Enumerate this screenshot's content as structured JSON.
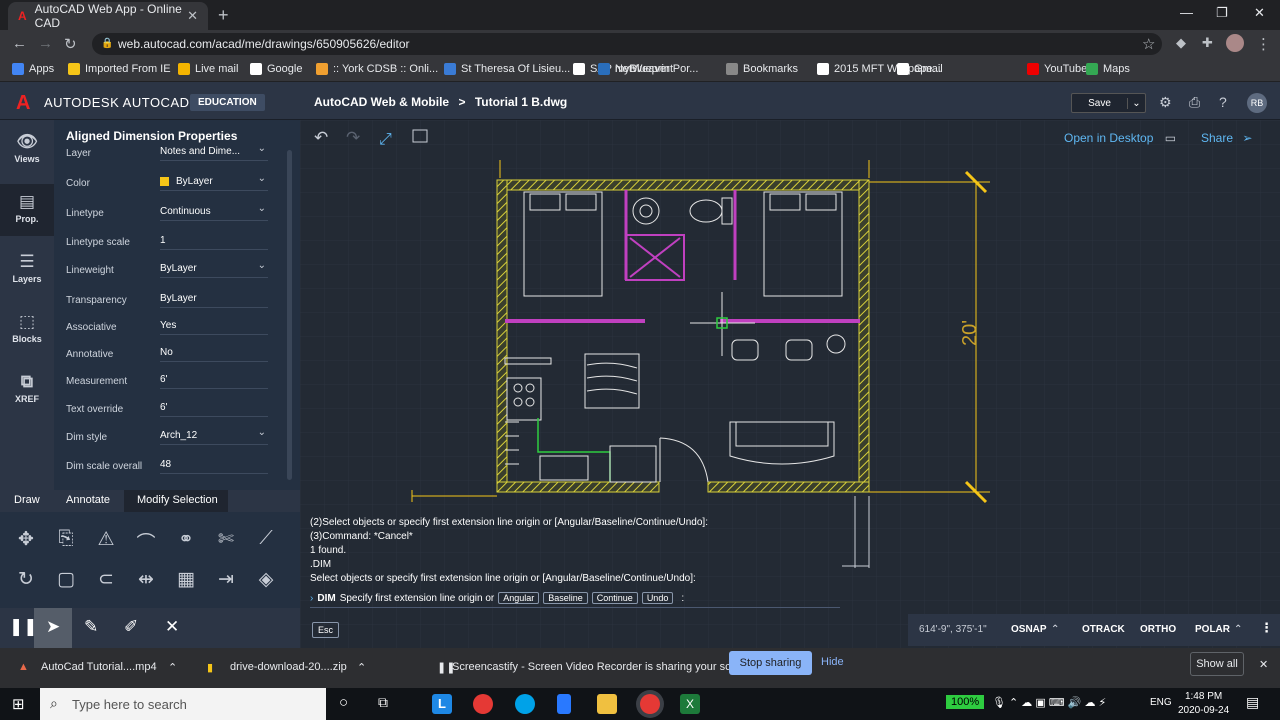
{
  "browser": {
    "tab_title": "AutoCAD Web App - Online CAD",
    "url": "web.autocad.com/acad/me/drawings/650905626/editor",
    "bookmarks": [
      "Apps",
      "Imported From IE",
      "Live mail",
      "Google",
      ":: York CDSB :: Onli...",
      "St Theresa Of Lisieu...",
      "SAP NetWeaver Por...",
      "myBlueprint",
      "Bookmarks",
      "2015 MFT Wallpape...",
      "Gmail",
      "YouTube",
      "Maps"
    ]
  },
  "app": {
    "brand": "AUTODESK AUTOCAD",
    "edition": "EDUCATION",
    "product": "AutoCAD Web & Mobile",
    "separator": ">",
    "file": "Tutorial 1 B.dwg",
    "save": "Save",
    "avatar": "RB",
    "open_desktop": "Open in Desktop",
    "share": "Share"
  },
  "rail": [
    {
      "label": "Views",
      "icon": "eye-icon"
    },
    {
      "label": "Prop.",
      "icon": "properties-icon"
    },
    {
      "label": "Layers",
      "icon": "layers-icon"
    },
    {
      "label": "Blocks",
      "icon": "blocks-icon"
    },
    {
      "label": "XREF",
      "icon": "xref-icon"
    }
  ],
  "properties": {
    "title": "Aligned Dimension Properties",
    "rows": [
      {
        "label": "Layer",
        "value": "Notes and Dime..."
      },
      {
        "label": "Color",
        "value": "ByLayer",
        "color": "#f5c518"
      },
      {
        "label": "Linetype",
        "value": "Continuous"
      },
      {
        "label": "Linetype scale",
        "value": "1"
      },
      {
        "label": "Lineweight",
        "value": "ByLayer"
      },
      {
        "label": "Transparency",
        "value": "ByLayer"
      },
      {
        "label": "Associative",
        "value": "Yes"
      },
      {
        "label": "Annotative",
        "value": "No"
      },
      {
        "label": "Measurement",
        "value": "6'"
      },
      {
        "label": "Text override",
        "value": "6'"
      },
      {
        "label": "Dim style",
        "value": "Arch_12"
      },
      {
        "label": "Dim scale overall",
        "value": "48"
      }
    ]
  },
  "tool_tabs": [
    "Draw",
    "Annotate",
    "Modify Selection"
  ],
  "command": {
    "history": [
      "(2)Select objects or specify first extension line origin or [Angular/Baseline/Continue/Undo]:",
      "(3)Command: *Cancel*",
      "1 found.",
      ".DIM",
      "Select objects or specify first extension line origin or [Angular/Baseline/Continue/Undo]:"
    ],
    "prompt_cmd": "DIM",
    "prompt_text": "Specify first extension line origin or",
    "options": [
      "Angular",
      "Baseline",
      "Continue",
      "Undo"
    ],
    "prompt_end": ":",
    "esc": "Esc"
  },
  "drawing": {
    "dim_text": "20'"
  },
  "status": {
    "coords": "614'-9\", 375'-1\"",
    "items": [
      "OSNAP",
      "OTRACK",
      "ORTHO",
      "POLAR"
    ]
  },
  "downloads": {
    "items": [
      "AutoCad Tutorial....mp4",
      "drive-download-20....zip"
    ],
    "notice": "Screencastify - Screen Video Recorder is sharing your screen.",
    "stop": "Stop sharing",
    "hide": "Hide",
    "show_all": "Show all"
  },
  "taskbar": {
    "search": "Type here to search",
    "battery": "100%",
    "lang": "ENG",
    "time": "1:48 PM",
    "date": "2020-09-24"
  },
  "colors": {
    "accent": "#5fb7f2",
    "wall": "#d8d03a",
    "magenta": "#c040c0",
    "dim": "#f5c518"
  }
}
